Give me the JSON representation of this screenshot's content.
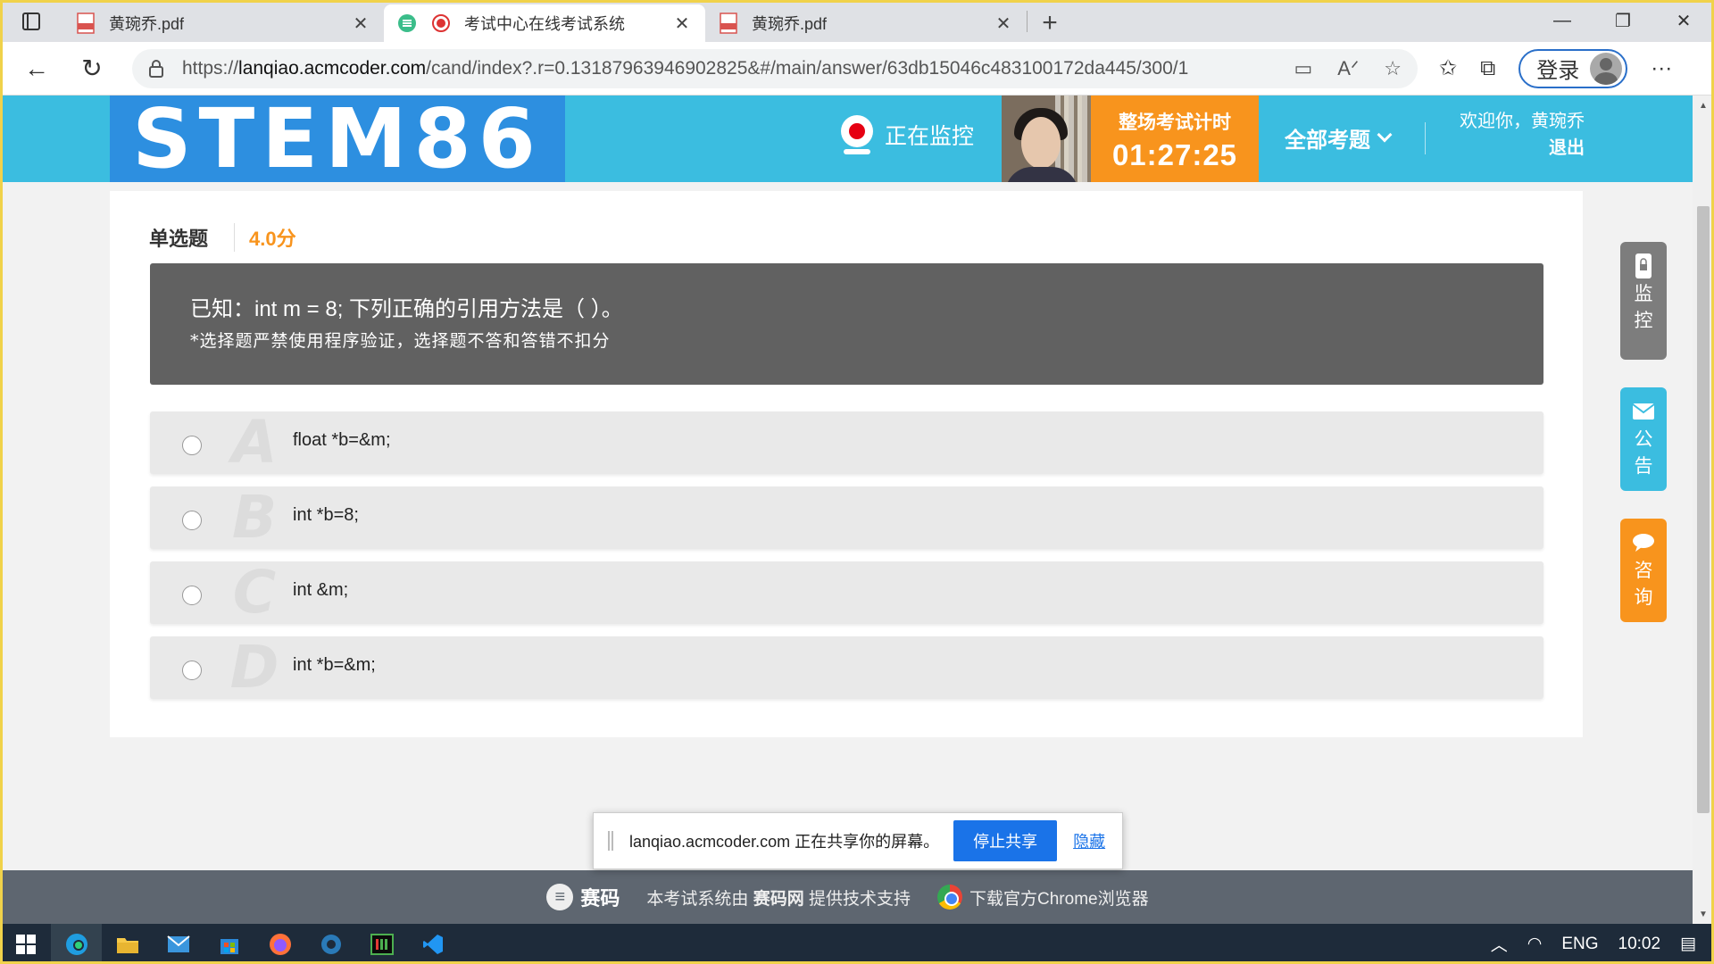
{
  "browser": {
    "tabs": [
      {
        "title": "黄琬乔.pdf",
        "active": false
      },
      {
        "title": "考试中心在线考试系统",
        "active": true
      },
      {
        "title": "黄琬乔.pdf",
        "active": false
      }
    ],
    "url_prefix": "https://",
    "url_host": "lanqiao.acmcoder.com",
    "url_path": "/cand/index?.r=0.13187963946902825&#/main/answer/63db15046c483100172da445/300/1",
    "login_label": "登录"
  },
  "header": {
    "logo_text": "STEM86",
    "monitoring_label": "正在监控",
    "timer_label": "整场考试计时",
    "timer_value": "01:27:25",
    "all_questions_label": "全部考题",
    "welcome_text": "欢迎你，黄琬乔",
    "logout_label": "退出"
  },
  "question": {
    "type": "单选题",
    "score": "4.0分",
    "text": "已知：int m = 8; 下列正确的引用方法是（   ）。",
    "note": "*选择题严禁使用程序验证，选择题不答和答错不扣分",
    "options": [
      {
        "letter": "A",
        "text": "float *b=&m;"
      },
      {
        "letter": "B",
        "text": "int *b=8;"
      },
      {
        "letter": "C",
        "text": "int &m;"
      },
      {
        "letter": "D",
        "text": "int *b=&m;"
      }
    ]
  },
  "side_widgets": {
    "monitor": [
      "监",
      "控"
    ],
    "announce": [
      "公",
      "告"
    ],
    "consult": [
      "咨",
      "询"
    ]
  },
  "share_bar": {
    "message": "lanqiao.acmcoder.com 正在共享你的屏幕。",
    "stop_label": "停止共享",
    "hide_label": "隐藏"
  },
  "footer": {
    "brand": "赛码",
    "support_pre": "本考试系统由",
    "support_brand": "赛码网",
    "support_post": "提供技术支持",
    "download": "下载官方Chrome浏览器"
  },
  "taskbar": {
    "lang": "ENG",
    "time": "10:02"
  },
  "colors": {
    "header_bg": "#3bbde0",
    "logo_bg": "#2d8fe0",
    "accent_orange": "#f8941d",
    "question_bg": "#616161",
    "footer_bg": "#5e6670"
  }
}
